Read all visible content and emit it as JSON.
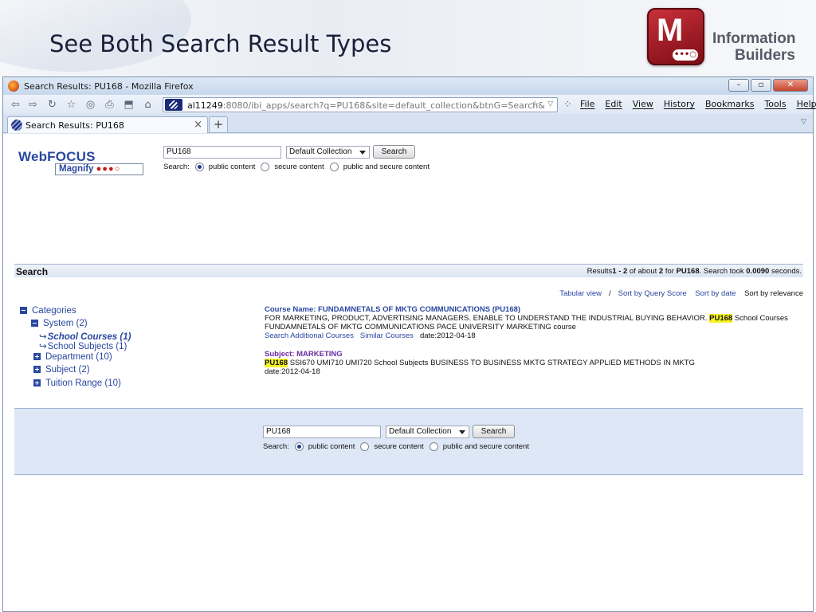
{
  "slide": {
    "title": "See Both Search Result Types",
    "logo_letter": "M",
    "logo_dots": "•••○",
    "company_line1": "Information",
    "company_line2": "Builders"
  },
  "window": {
    "title": "Search Results: PU168 - Mozilla Firefox",
    "buttons": {
      "minimize": "–",
      "maximize": "▫",
      "close": "✕"
    }
  },
  "toolbar": {
    "url_host": "al11249",
    "url_rest": ":8080/ibi_apps/search?q=PU168&site=default_collection&btnG=Search&",
    "menu": [
      "File",
      "Edit",
      "View",
      "History",
      "Bookmarks",
      "Tools",
      "Help"
    ]
  },
  "tab": {
    "label": "Search Results: PU168",
    "close": "×",
    "new_tab": "+"
  },
  "brand": {
    "name": "WebFOCUS",
    "product": "Magnify",
    "dots": "●●●○"
  },
  "search": {
    "query": "PU168",
    "collection": "Default Collection",
    "button": "Search",
    "scope_label": "Search:",
    "scopes": [
      "public content",
      "secure content",
      "public and secure content"
    ],
    "selected_scope": 0
  },
  "results_header": {
    "label": "Search",
    "stats_prefix": "Results",
    "range": "1 - 2",
    "of_about": " of about ",
    "total": "2",
    "for": " for ",
    "query": "PU168",
    "took": ". Search took ",
    "seconds": "0.0090",
    "suffix": " seconds."
  },
  "sort": {
    "tabular": "Tabular view",
    "separator": "/",
    "by_score": "Sort by Query Score",
    "by_date": "Sort by date",
    "by_relevance": "Sort by relevance"
  },
  "categories": {
    "root": "Categories",
    "system": "System  (2)",
    "school_courses": "School Courses (1)",
    "school_subjects": "School Subjects (1)",
    "department": "Department  (10)",
    "subject": "Subject  (2)",
    "tuition": "Tuition Range  (10)"
  },
  "results": [
    {
      "title": "Course Name: FUNDAMNETALS OF MKTG COMMUNICATIONS (PU168)",
      "body_before": "FOR MARKETING, PRODUCT, ADVERTISING MANAGERS. ENABLE TO UNDERSTAND THE INDUSTRIAL BUYING BEHAVIOR. ",
      "highlight": "PU168",
      "body_after": " School Courses FUNDAMNETALS OF MKTG COMMUNICATIONS PACE UNIVERSITY MARKETING course",
      "link1": "Search Additional Courses",
      "link2": "Similar Courses",
      "date": "date:2012-04-18"
    },
    {
      "title": "Subject: MARKETING",
      "highlight": "PU168",
      "body_after": " SSI670 UMI710 UMI720 School Subjects BUSINESS TO BUSINESS MKTG STRATEGY APPLIED METHODS IN MKTG",
      "date": "date:2012-04-18"
    }
  ]
}
